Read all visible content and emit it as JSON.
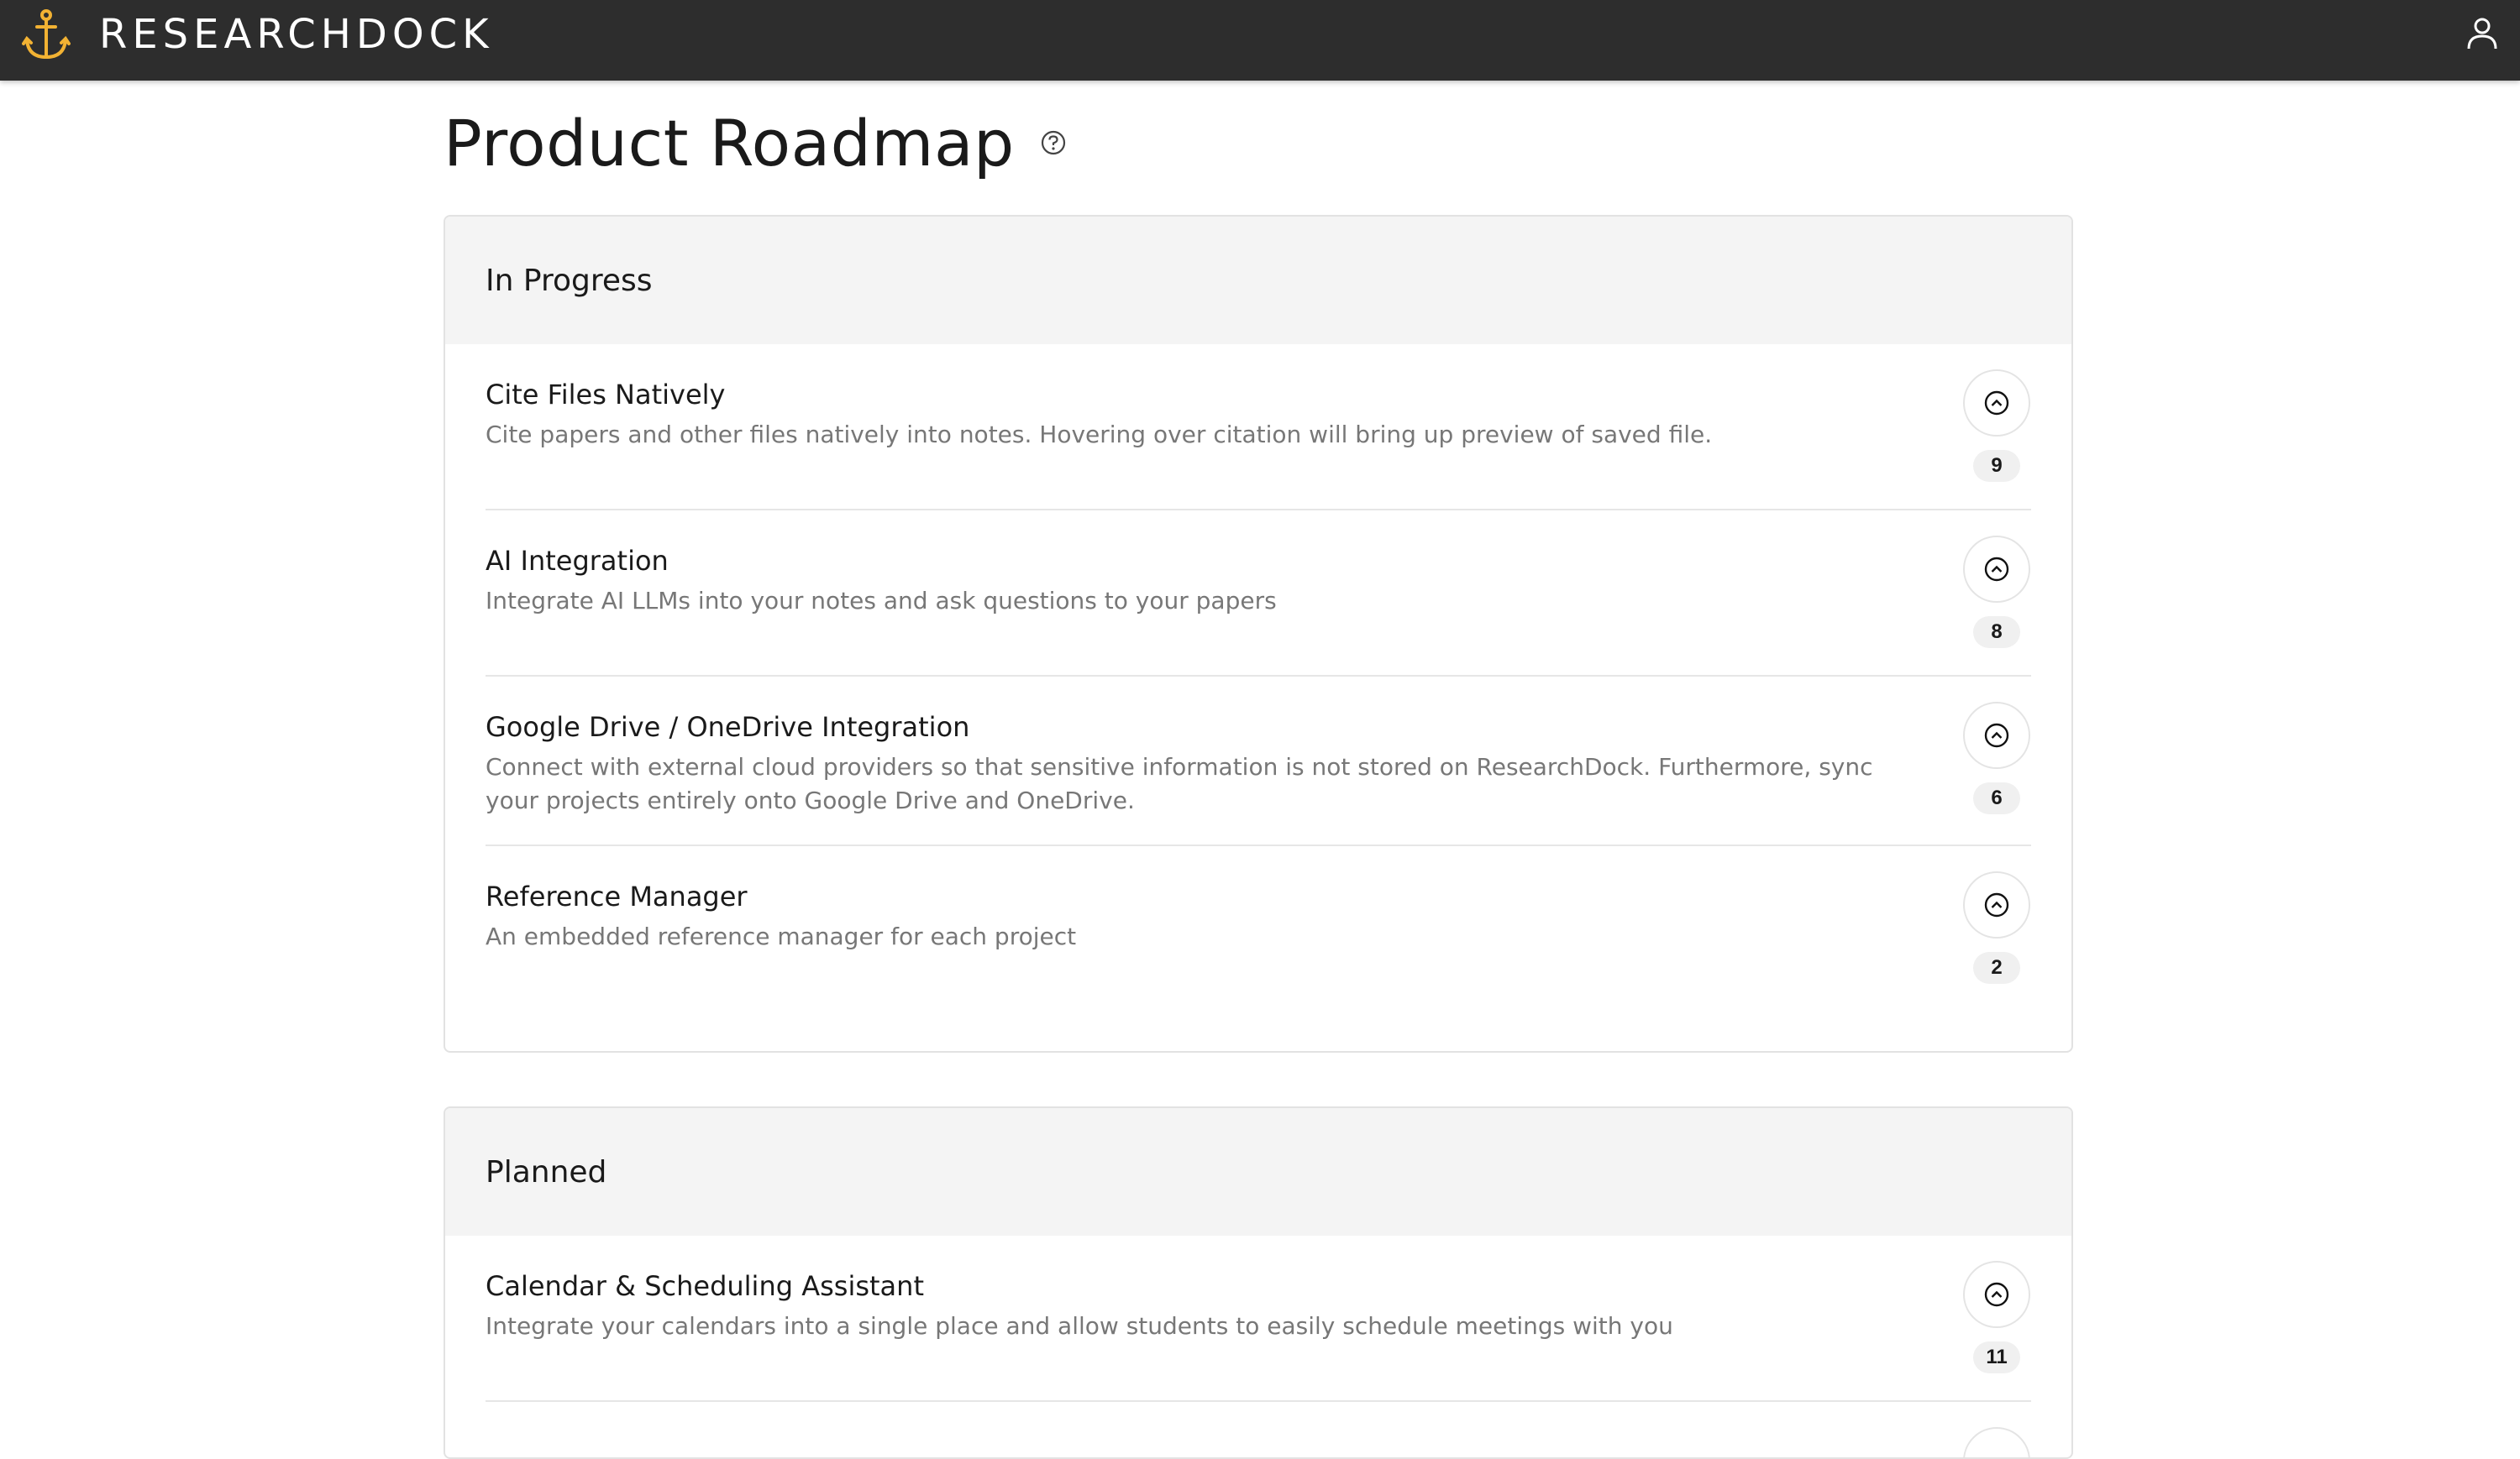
{
  "header": {
    "brand": "RESEARCHDOCK",
    "logo_icon": "anchor-icon",
    "user_icon": "user-icon",
    "accent": "#f2b233"
  },
  "page": {
    "title": "Product Roadmap",
    "help_icon": "question-circle-icon"
  },
  "sections": [
    {
      "title": "In Progress",
      "items": [
        {
          "title": "Cite Files Natively",
          "description": "Cite papers and other files natively into notes. Hovering over citation will bring up preview of saved file.",
          "votes": "9"
        },
        {
          "title": "AI Integration",
          "description": "Integrate AI LLMs into your notes and ask questions to your papers",
          "votes": "8"
        },
        {
          "title": "Google Drive / OneDrive Integration",
          "description": "Connect with external cloud providers so that sensitive information is not stored on ResearchDock. Furthermore, sync your projects entirely onto Google Drive and OneDrive.",
          "votes": "6"
        },
        {
          "title": "Reference Manager",
          "description": "An embedded reference manager for each project",
          "votes": "2"
        }
      ]
    },
    {
      "title": "Planned",
      "items": [
        {
          "title": "Calendar & Scheduling Assistant",
          "description": "Integrate your calendars into a single place and allow students to easily schedule meetings with you",
          "votes": "11"
        },
        {
          "title": "",
          "description": "",
          "votes": ""
        }
      ]
    }
  ]
}
